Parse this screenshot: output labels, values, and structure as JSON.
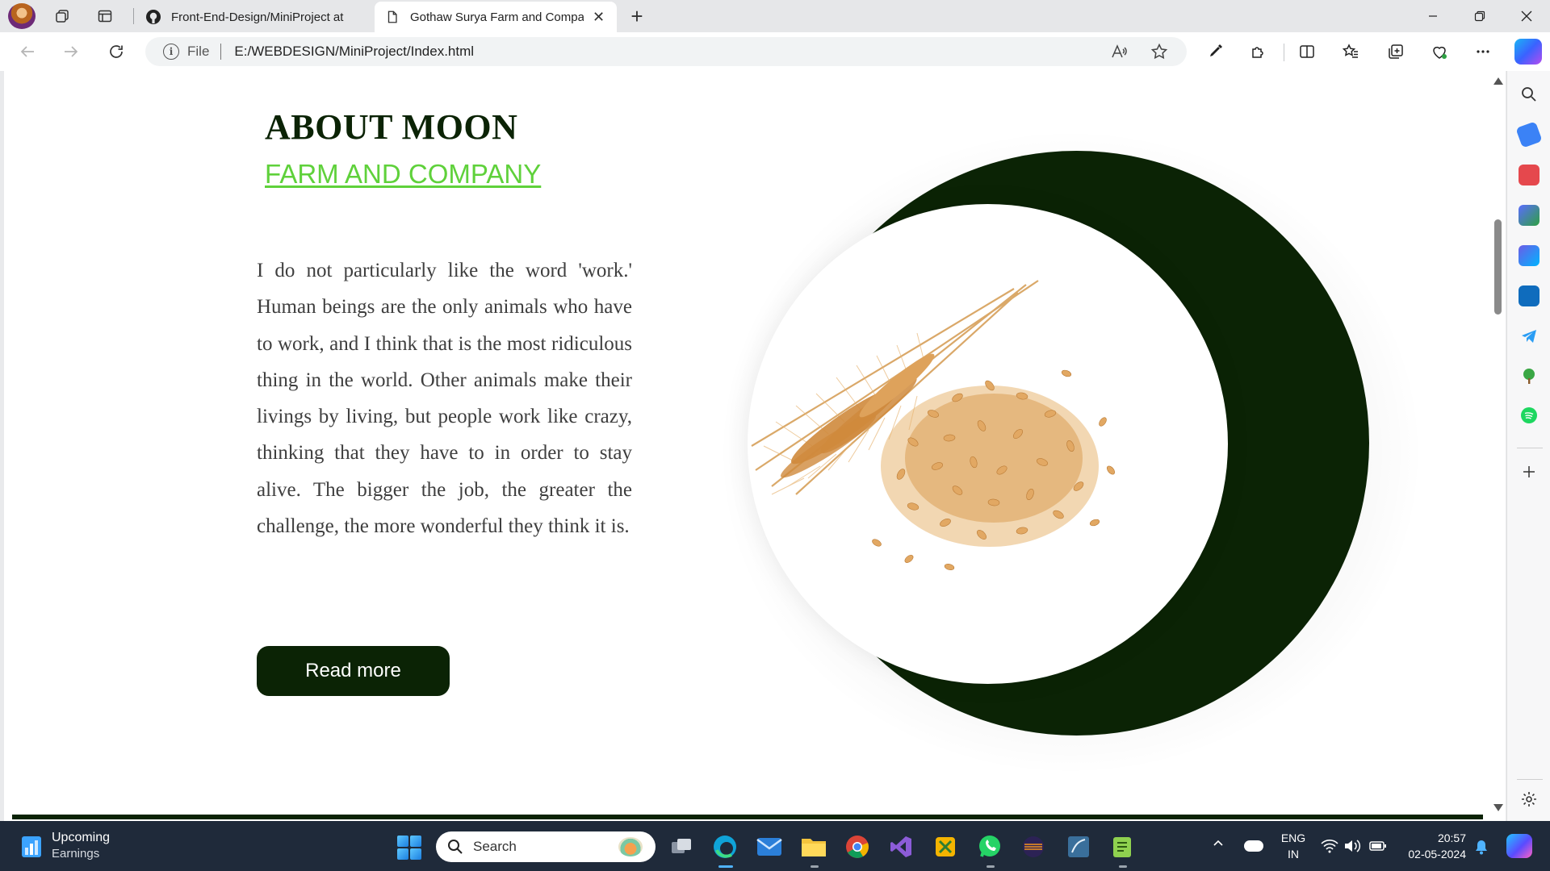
{
  "browser": {
    "tabs": [
      {
        "title": "Front-End-Design/MiniProject at",
        "active": false,
        "favicon": "github-icon"
      },
      {
        "title": "Gothaw Surya Farm and Compan",
        "active": true,
        "favicon": "document-icon"
      }
    ],
    "address": {
      "scheme": "File",
      "url": "E:/WEBDESIGN/MiniProject/Index.html"
    }
  },
  "page": {
    "title": "ABOUT MOON",
    "subtitle": "FARM AND COMPANY",
    "paragraph": "I do not particularly like the word 'work.' Human beings are the only animals who have to work, and I think that is the most ridiculous thing in the world. Other animals make their livings by living, but people work like crazy, thinking that they have to in order to stay alive. The bigger the job, the greater the challenge, the more wonderful they think it is.",
    "button": "Read more",
    "colors": {
      "dark_green": "#0b2305",
      "accent_green": "#5fd13b",
      "text_gray": "#3e3e3e"
    },
    "image": "wheat-grains-illustration"
  },
  "taskbar": {
    "weather": {
      "title": "Upcoming",
      "subtitle": "Earnings"
    },
    "search_placeholder": "Search",
    "language": {
      "line1": "ENG",
      "line2": "IN"
    },
    "time": "20:57",
    "date": "02-05-2024"
  }
}
